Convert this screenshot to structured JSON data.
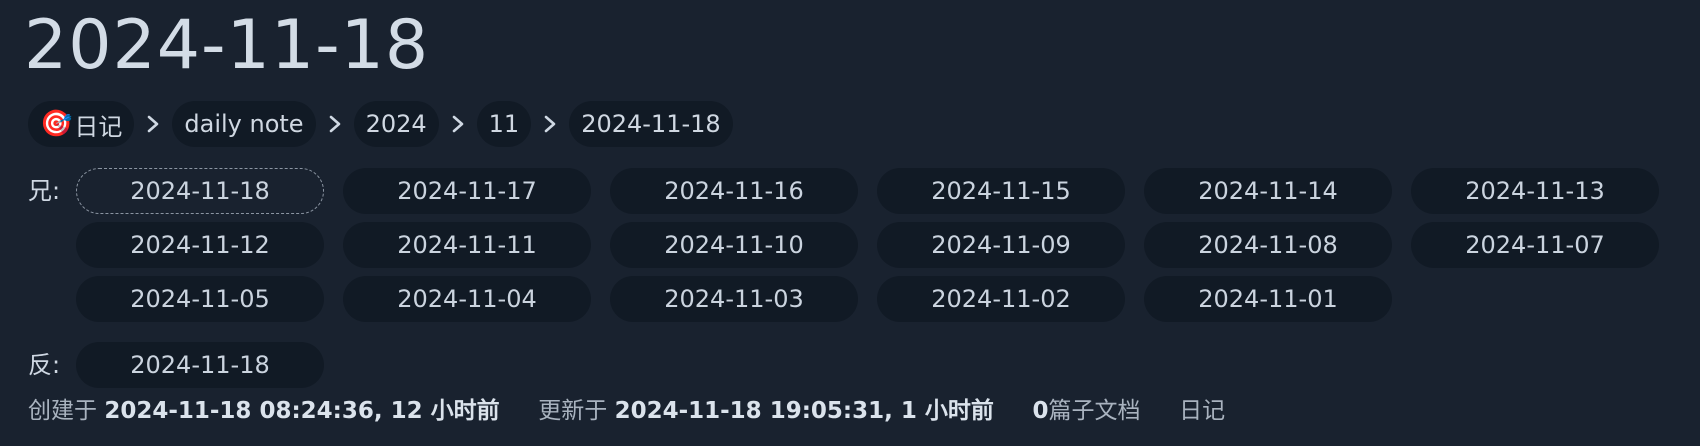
{
  "title": "2024-11-18",
  "breadcrumb": {
    "items": [
      {
        "emoji": "🎯",
        "label": "日记"
      },
      {
        "label": "daily note"
      },
      {
        "label": "2024"
      },
      {
        "label": "11"
      },
      {
        "label": "2024-11-18"
      }
    ]
  },
  "siblings": {
    "label": "兄:",
    "items": [
      "2024-11-18",
      "2024-11-17",
      "2024-11-16",
      "2024-11-15",
      "2024-11-14",
      "2024-11-13",
      "2024-11-12",
      "2024-11-11",
      "2024-11-10",
      "2024-11-09",
      "2024-11-08",
      "2024-11-07",
      "2024-11-05",
      "2024-11-04",
      "2024-11-03",
      "2024-11-02",
      "2024-11-01"
    ]
  },
  "backlinks": {
    "label": "反:",
    "items": [
      "2024-11-18"
    ]
  },
  "meta": {
    "created_label": "创建于",
    "created_value": "2024-11-18 08:24:36, 12 小时前",
    "updated_label": "更新于",
    "updated_value": "2024-11-18 19:05:31, 1 小时前",
    "subdoc_count": "0",
    "subdoc_label": "篇子文档",
    "notebook": "日记"
  }
}
